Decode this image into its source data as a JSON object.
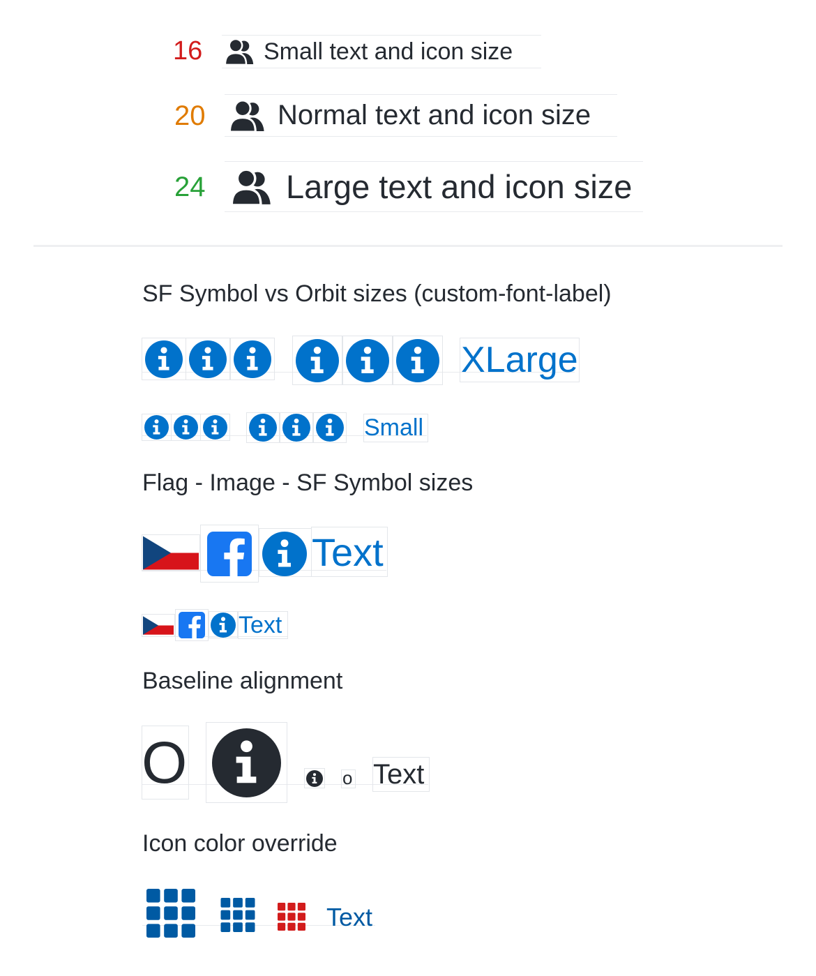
{
  "size_rows": [
    {
      "number": "16",
      "color": "#d21c1c",
      "label": "Small text and icon size"
    },
    {
      "number": "20",
      "color": "#e07b00",
      "label": "Normal text and icon size"
    },
    {
      "number": "24",
      "color": "#28a138",
      "label": "Large text and icon size"
    }
  ],
  "sections": {
    "sf_vs_orbit": "SF Symbol vs Orbit sizes (custom-font-label)",
    "flag_image": "Flag - Image - SF Symbol sizes",
    "baseline": "Baseline alignment",
    "icon_color": "Icon color override"
  },
  "labels": {
    "xlarge": "XLarge",
    "small": "Small",
    "text_large": "Text",
    "text_small": "Text",
    "baseline_o_large": "O",
    "baseline_o_small": "o",
    "baseline_text": "Text",
    "color_text": "Text"
  },
  "colors": {
    "info_blue": "#0172cb",
    "ink": "#252a31",
    "orbit_blue": "#005aa3",
    "override_red": "#d21c1c",
    "facebook": "#1877f2",
    "flag_blue": "#11457e",
    "flag_red": "#d7141a"
  },
  "icons": {
    "people": "people-icon",
    "info": "information-circle-icon",
    "flag": "czech-flag",
    "facebook": "facebook-logo",
    "grid": "grid-icon"
  }
}
